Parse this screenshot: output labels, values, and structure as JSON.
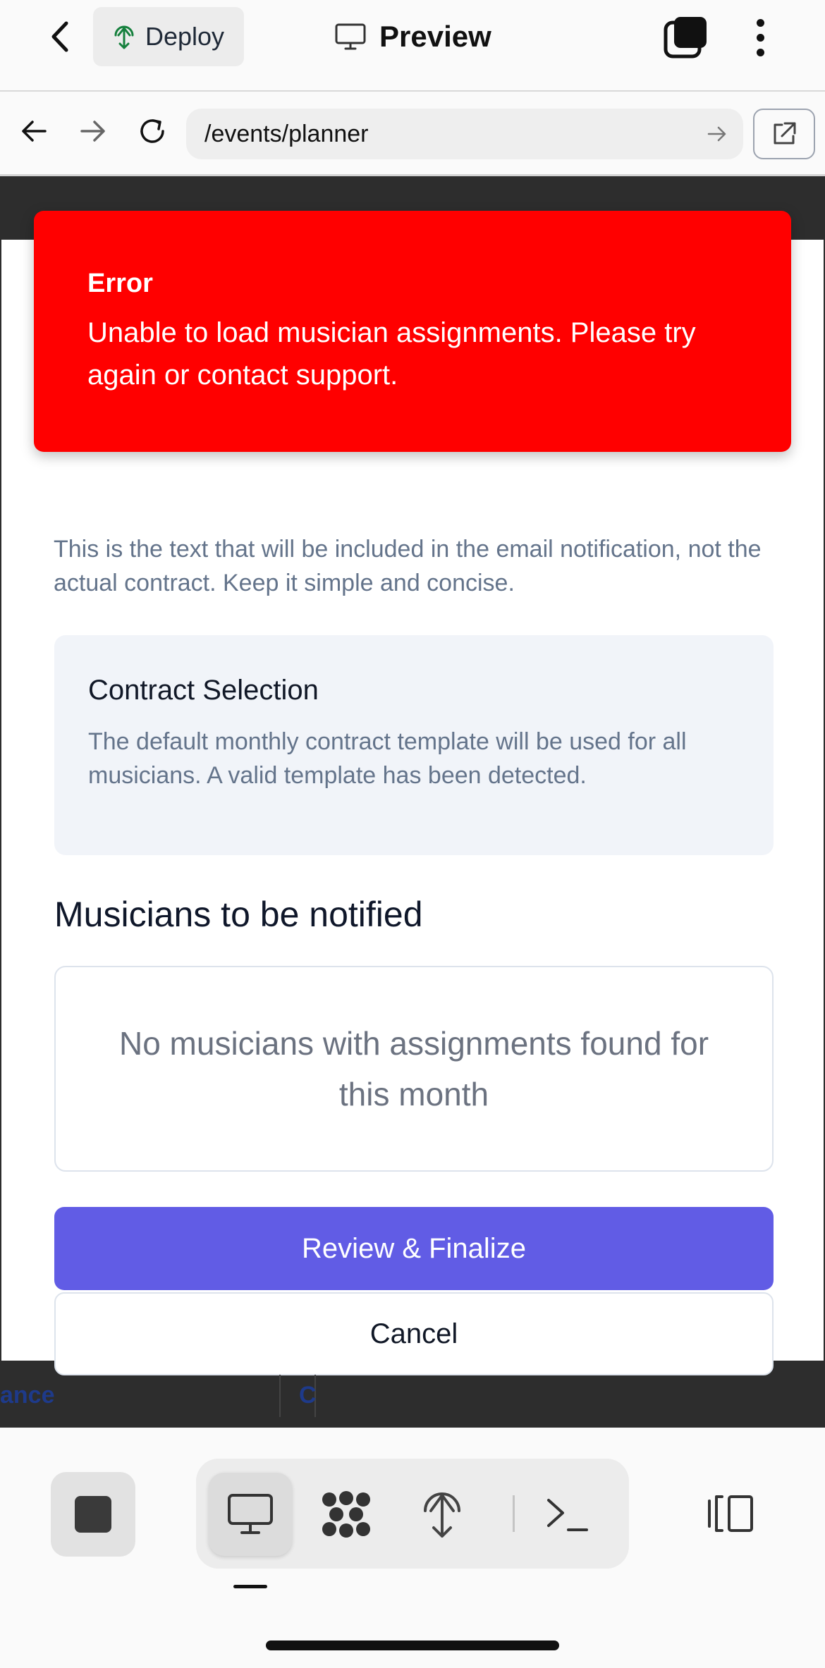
{
  "app": {
    "deploy_label": "Deploy",
    "preview_label": "Preview"
  },
  "browser": {
    "url": "/events/planner"
  },
  "toast": {
    "title": "Error",
    "message": "Unable to load musician assignments. Please try again or contact support.",
    "color": "#ff0000"
  },
  "form": {
    "email_hint": "This is the text that will be included in the email notification, not the actual contract. Keep it simple and concise.",
    "contract_title": "Contract Selection",
    "contract_text": "The default monthly contract template will be used for all musicians. A valid template has been detected.",
    "musicians_heading": "Musicians to be notified",
    "empty_message": "No musicians with assignments found for this month",
    "review_label": "Review & Finalize",
    "cancel_label": "Cancel",
    "accent_color": "#615ce5"
  },
  "background_table": {
    "cell_1": "ance",
    "cell_2": "C"
  },
  "toolbar": {
    "icons": [
      "stop-icon",
      "monitor-icon",
      "apps-icon",
      "deploy-icon",
      "terminal-icon",
      "panel-toggle-icon"
    ]
  }
}
